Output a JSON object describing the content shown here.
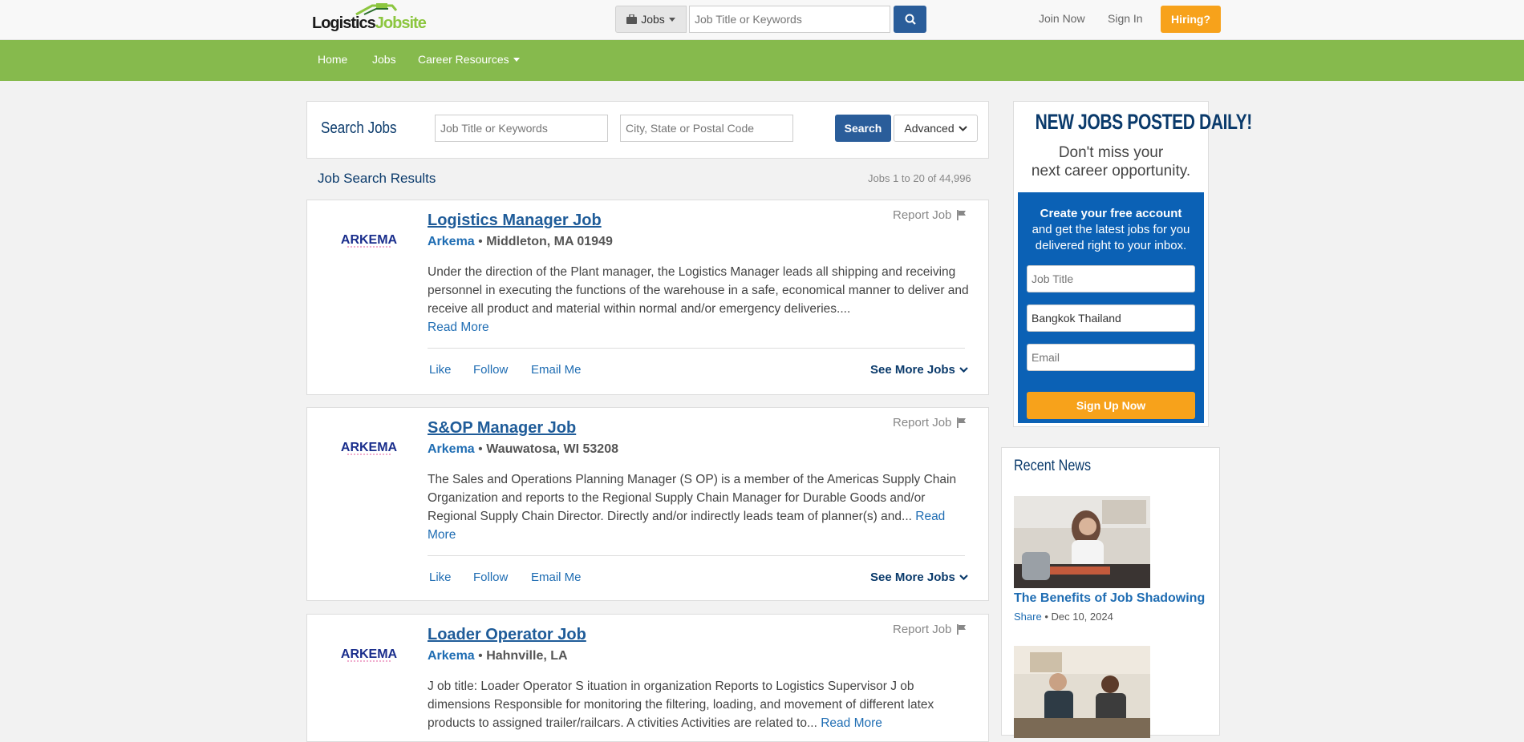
{
  "header": {
    "logo": {
      "part1": "Logistics",
      "part2": "Jobsite"
    },
    "jobs_dropdown": "Jobs",
    "search_placeholder": "Job Title or Keywords",
    "join_now": "Join Now",
    "sign_in": "Sign In",
    "hiring": "Hiring?"
  },
  "nav": {
    "items": [
      "Home",
      "Jobs",
      "Career Resources"
    ]
  },
  "search": {
    "title": "Search Jobs",
    "keyword_placeholder": "Job Title or Keywords",
    "location_placeholder": "City, State or Postal Code",
    "search_button": "Search",
    "advanced_button": "Advanced"
  },
  "results": {
    "title": "Job Search Results",
    "count": "Jobs 1 to 20 of 44,996"
  },
  "jobs": [
    {
      "title": "Logistics Manager Job",
      "company": "Arkema",
      "location": "Middleton, MA 01949",
      "description": "Under the direction of the Plant manager, the Logistics Manager leads all shipping and receiving personnel in executing the functions of the warehouse in a safe, economical manner to deliver and receive all product and material within normal and/or emergency deliveries....",
      "read_more": "Read More",
      "report": "Report Job",
      "like": "Like",
      "follow": "Follow",
      "email": "Email Me",
      "see_more": "See More Jobs"
    },
    {
      "title": "S&OP Manager Job",
      "company": "Arkema",
      "location": "Wauwatosa, WI 53208",
      "description": "The Sales and Operations Planning Manager (S OP) is a member of the Americas Supply Chain Organization and reports to the Regional Supply Chain Manager for Durable Goods and/or Regional Supply Chain Director. Directly and/or indirectly leads team of planner(s) and...",
      "read_more": "Read More",
      "report": "Report Job",
      "like": "Like",
      "follow": "Follow",
      "email": "Email Me",
      "see_more": "See More Jobs"
    },
    {
      "title": "Loader Operator Job",
      "company": "Arkema",
      "location": "Hahnville, LA",
      "description": "J ob title: Loader Operator S ituation in organization Reports to Logistics Supervisor J ob dimensions Responsible for monitoring the filtering, loading, and movement of different latex products to assigned trailer/railcars. A ctivities Activities are related to...",
      "read_more": "Read More",
      "report": "Report Job"
    }
  ],
  "company_logo_text": "ARKEMA",
  "promo": {
    "headline": "NEW JOBS POSTED DAILY!",
    "sub1": "Don't miss your",
    "sub2": "next career opportunity.",
    "box_line1": "Create your free account",
    "box_line2": "and get the latest jobs for you delivered right to your inbox.",
    "job_title_placeholder": "Job Title",
    "location_value": "Bangkok Thailand",
    "email_placeholder": "Email",
    "signup": "Sign Up Now"
  },
  "news": {
    "title": "Recent News",
    "items": [
      {
        "headline": "The Benefits of Job Shadowing",
        "share": "Share",
        "date": "Dec 10, 2024"
      }
    ]
  },
  "colors": {
    "nav_green": "#86ba4d",
    "primary_blue": "#2a5d9a",
    "link_blue": "#1f6db3",
    "orange": "#f7a21b",
    "promo_blue": "#0b61b5"
  }
}
